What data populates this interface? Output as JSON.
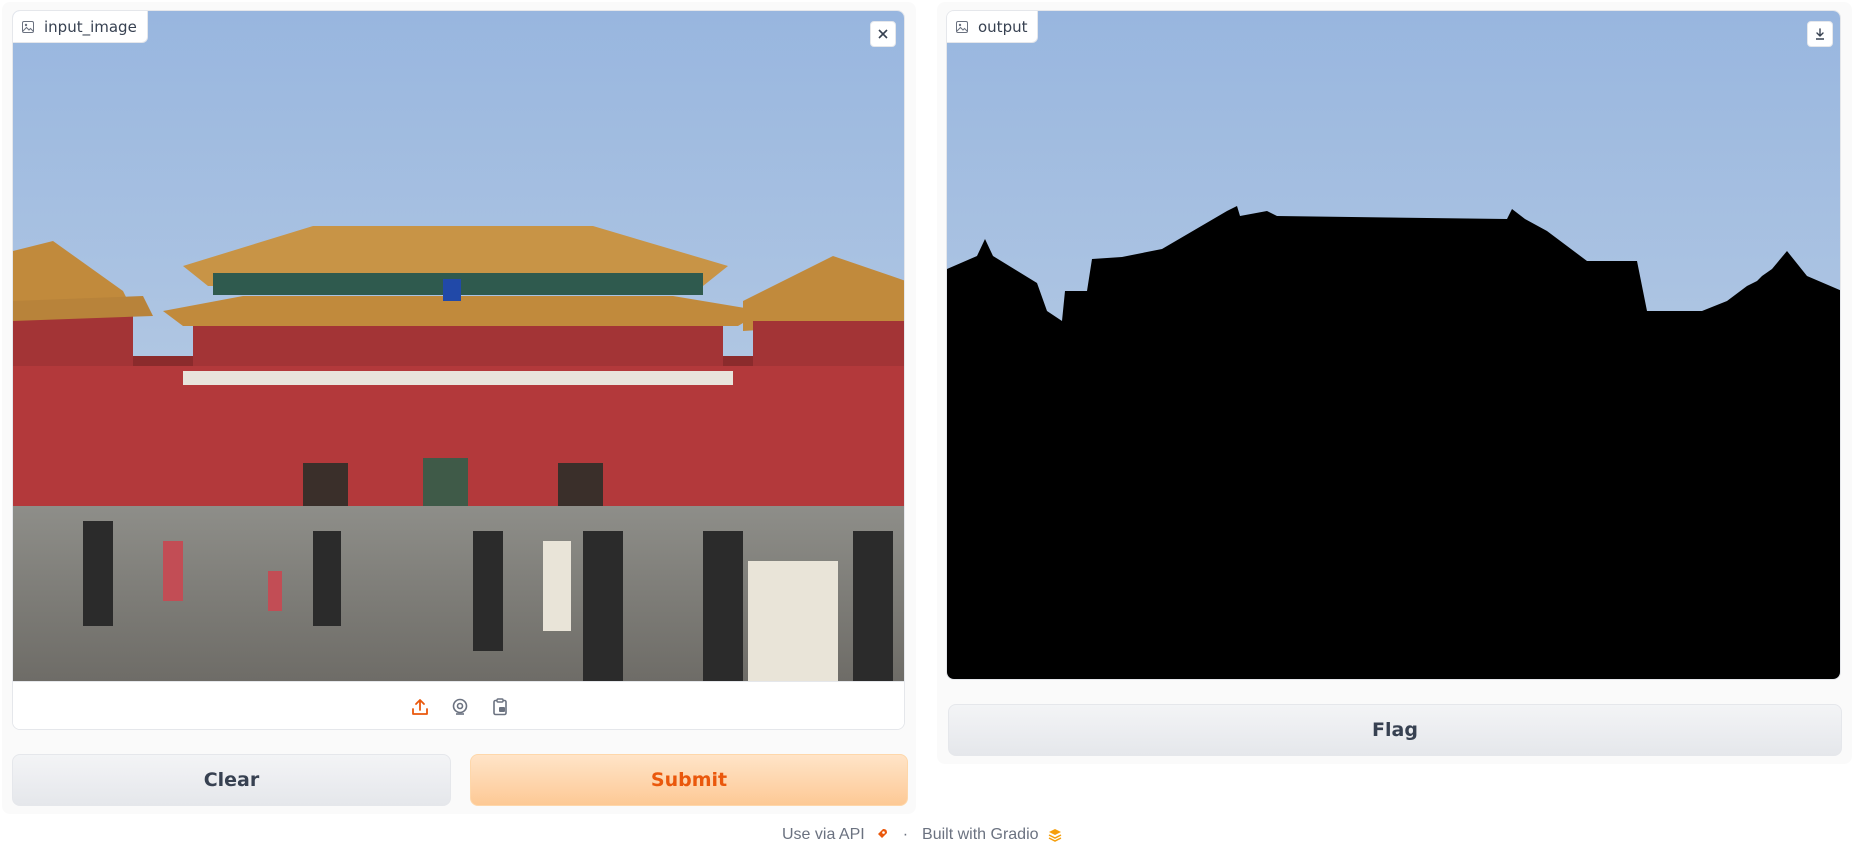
{
  "input": {
    "label": "input_image",
    "close_icon": "close-icon",
    "sources": [
      "upload-icon",
      "webcam-icon",
      "clipboard-icon"
    ]
  },
  "output": {
    "label": "output",
    "download_icon": "download-icon"
  },
  "buttons": {
    "clear": "Clear",
    "submit": "Submit",
    "flag": "Flag"
  },
  "footer": {
    "api": "Use via API",
    "separator": "·",
    "built": "Built with Gradio"
  },
  "colors": {
    "accent": "#ea580c",
    "submit_bg": "#fdc995",
    "sky": "#a9c4e4",
    "wall": "#b3393b",
    "roof": "#c18a3c"
  }
}
